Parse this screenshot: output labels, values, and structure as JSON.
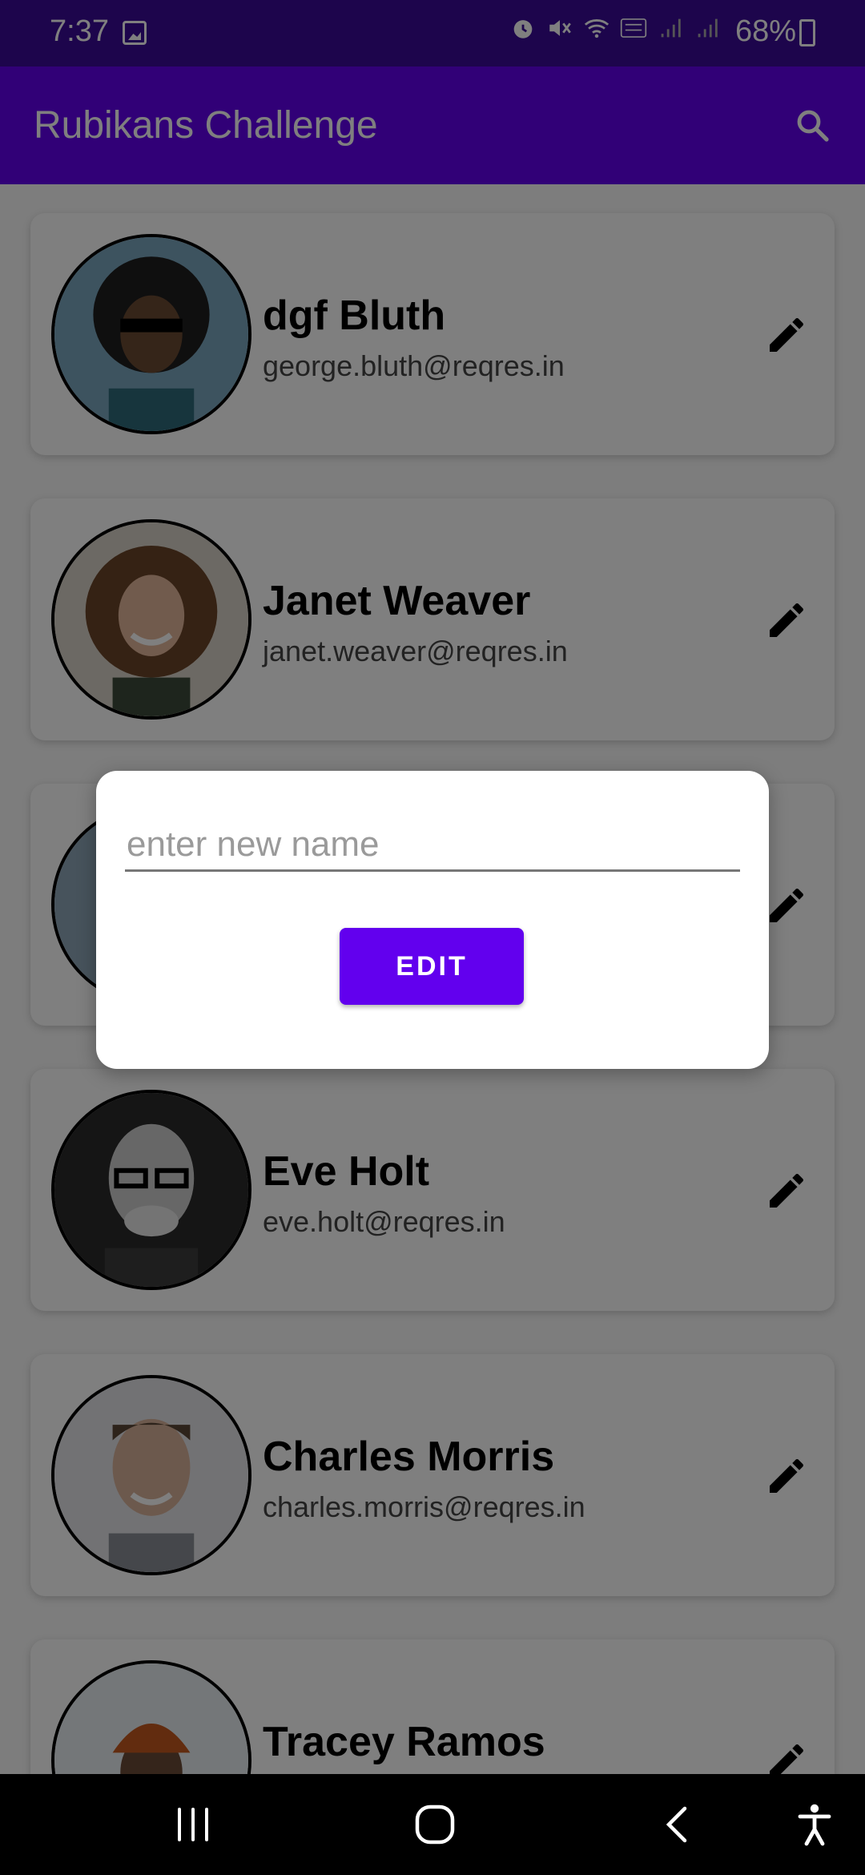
{
  "status_bar": {
    "time": "7:37",
    "battery_percent": "68%",
    "icons": [
      "gallery-icon",
      "alarm-icon",
      "mute-icon",
      "wifi-icon",
      "volte-icon",
      "signal-icon",
      "signal-icon",
      "battery-icon"
    ]
  },
  "app_bar": {
    "title": "Rubikans Challenge",
    "search_icon": "search-icon"
  },
  "users": [
    {
      "name": "dgf Bluth",
      "email": "george.bluth@reqres.in"
    },
    {
      "name": "Janet Weaver",
      "email": "janet.weaver@reqres.in"
    },
    {
      "name": "",
      "email": ""
    },
    {
      "name": "Eve Holt",
      "email": "eve.holt@reqres.in"
    },
    {
      "name": "Charles Morris",
      "email": "charles.morris@reqres.in"
    },
    {
      "name": "Tracey Ramos",
      "email": ""
    }
  ],
  "dialog": {
    "placeholder": "enter new name",
    "value": "",
    "button_label": "EDIT"
  },
  "colors": {
    "primary": "#6200ee",
    "status_bar": "#3a0a99"
  }
}
